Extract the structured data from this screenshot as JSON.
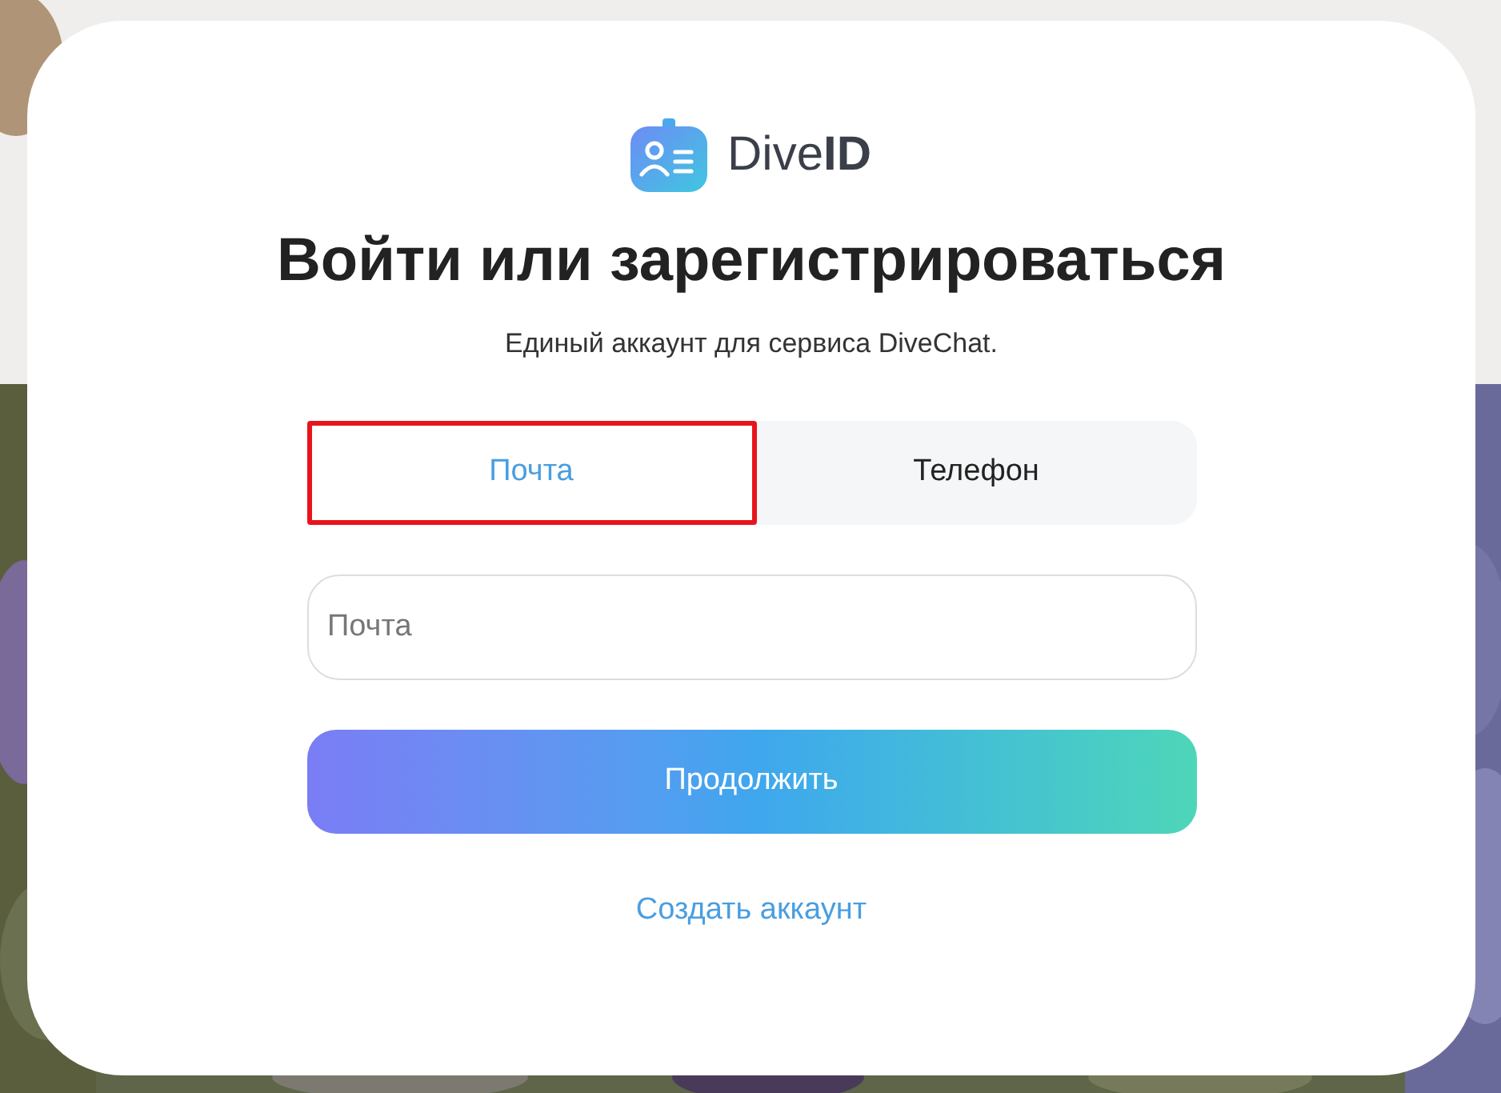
{
  "logo": {
    "text_light": "Dive",
    "text_bold": "ID"
  },
  "title": "Войти или зарегистрироваться",
  "subtitle": "Единый аккаунт для сервиса DiveChat.",
  "tabs": [
    {
      "label": "Почта",
      "selected": true,
      "highlighted": true
    },
    {
      "label": "Телефон",
      "selected": false,
      "highlighted": false
    }
  ],
  "email_field": {
    "placeholder": "Почта"
  },
  "continue_button": "Продолжить",
  "create_account_link": "Создать аккаунт"
}
